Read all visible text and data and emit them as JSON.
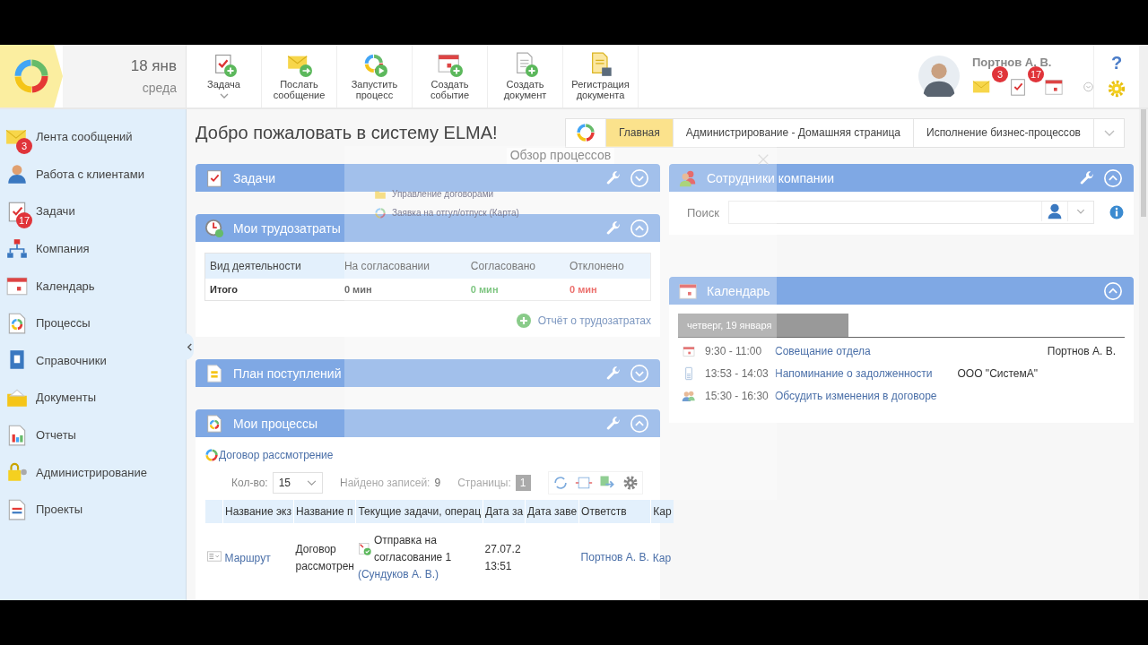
{
  "header": {
    "date": "18 янв",
    "weekday": "среда",
    "toolbar": [
      {
        "label": "Задача",
        "kind": "task",
        "has_menu": true
      },
      {
        "label": "Послать сообщение",
        "kind": "message",
        "has_menu": false
      },
      {
        "label": "Запустить процесс",
        "kind": "process",
        "has_menu": false
      },
      {
        "label": "Создать событие",
        "kind": "event",
        "has_menu": false
      },
      {
        "label": "Создать документ",
        "kind": "document",
        "has_menu": false
      },
      {
        "label": "Регистрация документа",
        "kind": "registration",
        "has_menu": false
      }
    ],
    "user": {
      "name": "Портнов А. В.",
      "indicators": [
        {
          "kind": "messages",
          "count": "3"
        },
        {
          "kind": "tasks",
          "count": "17"
        },
        {
          "kind": "calendar"
        }
      ]
    },
    "help": "?"
  },
  "sidebar": {
    "items": [
      {
        "label": "Лента сообщений",
        "kind": "messages",
        "badge": "3"
      },
      {
        "label": "Работа с клиентами",
        "kind": "clients"
      },
      {
        "label": "Задачи",
        "kind": "tasks",
        "badge": "17"
      },
      {
        "label": "Компания",
        "kind": "company"
      },
      {
        "label": "Календарь",
        "kind": "calendar"
      },
      {
        "label": "Процессы",
        "kind": "processes"
      },
      {
        "label": "Справочники",
        "kind": "catalogs"
      },
      {
        "label": "Документы",
        "kind": "documents"
      },
      {
        "label": "Отчеты",
        "kind": "reports"
      },
      {
        "label": "Администрирование",
        "kind": "admin"
      },
      {
        "label": "Проекты",
        "kind": "projects"
      }
    ]
  },
  "page_title": "Добро пожаловать в систему ELMA!",
  "home_tabs": [
    {
      "label": "Главная",
      "selected": true
    },
    {
      "label": "Администрирование - Домашняя страница",
      "selected": false
    },
    {
      "label": "Исполнение бизнес-процессов",
      "selected": false
    }
  ],
  "left_portlets": [
    {
      "kind": "tasks",
      "title": "Задачи",
      "expanded": false
    },
    {
      "kind": "labor",
      "title": "Мои трудозатраты",
      "expanded": true,
      "columns": [
        "Вид деятельности",
        "На согласовании",
        "Согласовано",
        "Отклонено"
      ],
      "total": [
        "Итого",
        "0 мин",
        "0 мин",
        "0 мин"
      ],
      "link": "Отчёт о трудозатратах"
    },
    {
      "kind": "plan",
      "title": "План поступлений",
      "expanded": false
    },
    {
      "kind": "processes",
      "title": "Мои процессы",
      "expanded": true,
      "process_link": "Договор рассмотрение",
      "pager": {
        "count_label": "Кол-во:",
        "count": "15",
        "found_label": "Найдено записей:",
        "found": "9",
        "pages_label": "Страницы:",
        "page": "1"
      },
      "columns": [
        "Название экз",
        "Название п",
        "Текущие задачи, операц",
        "Дата за",
        "Дата заве",
        "Ответств",
        "Кар"
      ],
      "rows": [
        {
          "instance": "Маршрут",
          "process": "Договор рассмотрен",
          "task": "Отправка на согласование 1",
          "task_user": "(Сундуков А. В.)",
          "date": "27.07.2",
          "time": "13:51",
          "responsible": "Портнов А. В.",
          "card": "Кар"
        }
      ]
    }
  ],
  "employees": {
    "title": "Сотрудники компании",
    "search_label": "Поиск",
    "expanded": true
  },
  "calendar": {
    "title": "Календарь",
    "expanded": true,
    "day": "четверг, 19 января",
    "events": [
      {
        "kind": "meeting",
        "time": "9:30 - 11:00",
        "title": "Совещание отдела",
        "person": "Портнов А. В."
      },
      {
        "kind": "call",
        "time": "13:53 - 14:03",
        "title": "Напоминание о задолженности",
        "org": "ООО \"СистемА\""
      },
      {
        "kind": "group",
        "time": "15:30 - 16:30",
        "title": "Обсудить изменения в договоре"
      }
    ]
  },
  "overlay": {
    "title": "Обзор процессов",
    "items": [
      {
        "label": "Управление договорами",
        "kind": "folder"
      },
      {
        "label": "Заявка на отгул/отпуск (Карта)",
        "kind": "process"
      }
    ]
  }
}
